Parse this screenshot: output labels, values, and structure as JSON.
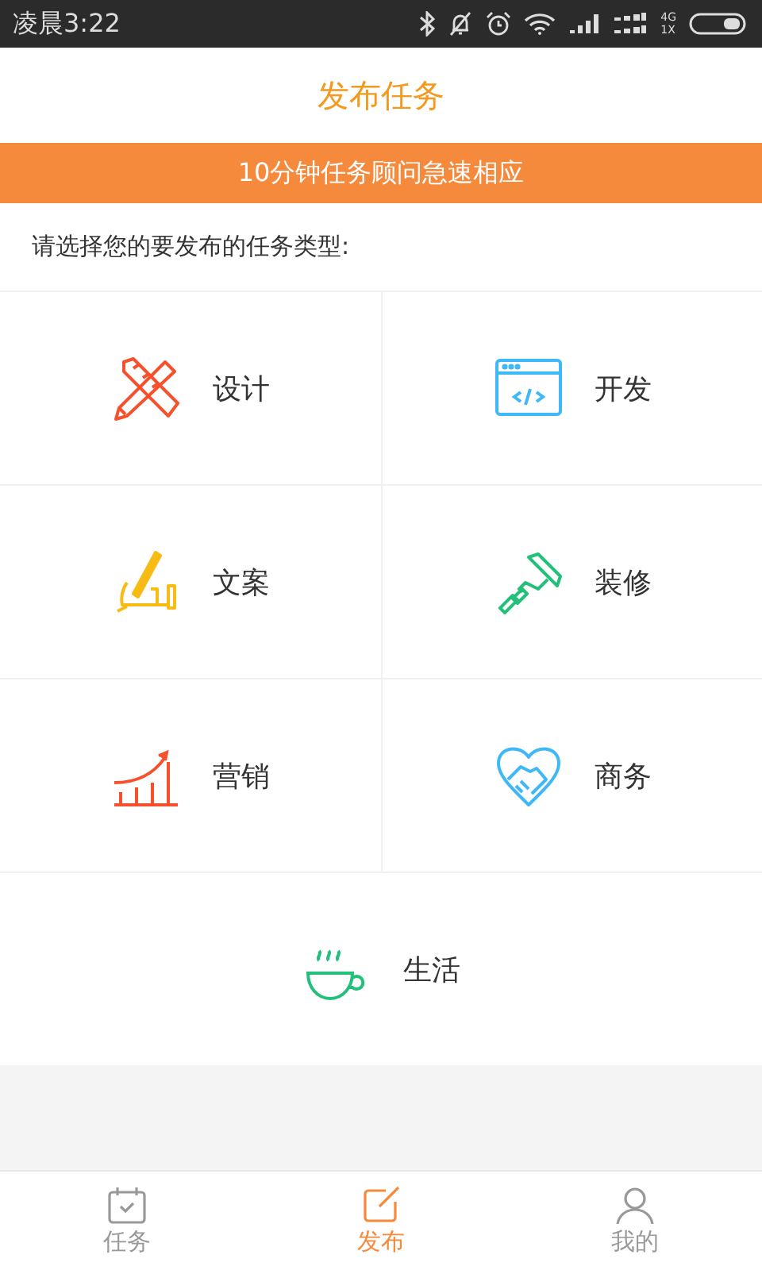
{
  "status_bar": {
    "time": "凌晨3:22",
    "network_labels": [
      "4G",
      "1X"
    ]
  },
  "header": {
    "title": "发布任务"
  },
  "banner": {
    "text": "10分钟任务顾问急速相应"
  },
  "prompt": "请选择您的要发布的任务类型:",
  "categories": [
    {
      "kind": "design",
      "label": "设计"
    },
    {
      "kind": "dev",
      "label": "开发"
    },
    {
      "kind": "copy",
      "label": "文案"
    },
    {
      "kind": "decor",
      "label": "装修"
    },
    {
      "kind": "marketing",
      "label": "营销"
    },
    {
      "kind": "business",
      "label": "商务"
    },
    {
      "kind": "life",
      "label": "生活"
    }
  ],
  "tab_bar": [
    {
      "kind": "tasks",
      "label": "任务",
      "selected": false
    },
    {
      "kind": "publish",
      "label": "发布",
      "selected": true
    },
    {
      "kind": "me",
      "label": "我的",
      "selected": false
    }
  ]
}
